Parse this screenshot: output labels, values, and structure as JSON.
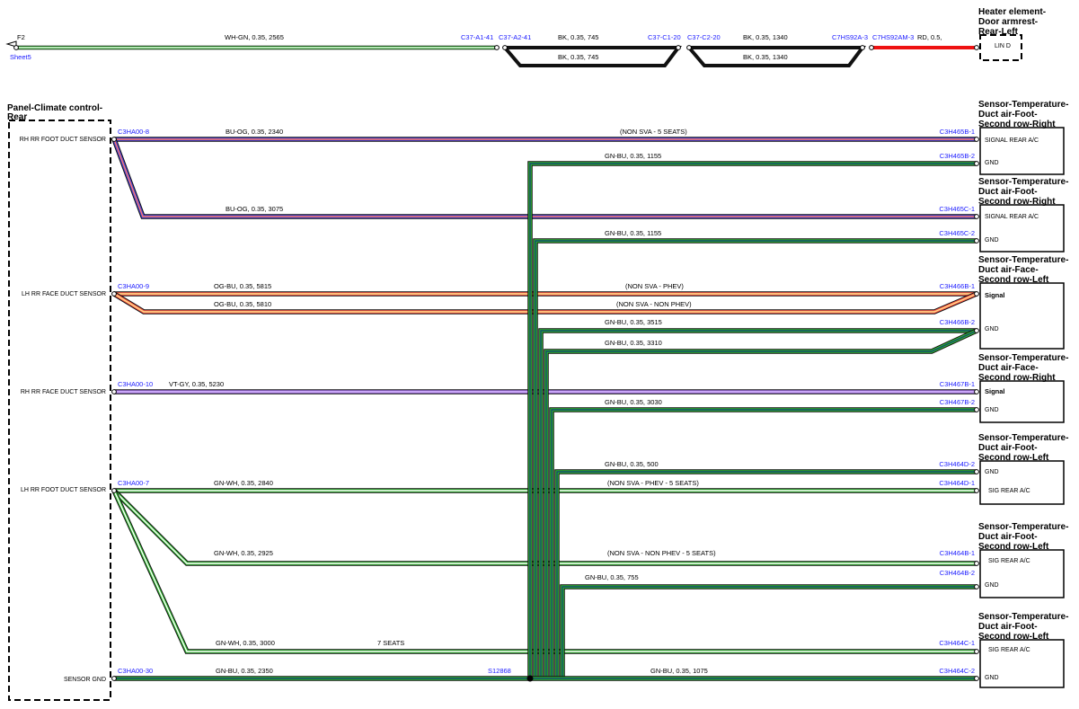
{
  "colors": {
    "connector_label": "#1a1aff",
    "wire_WH-GN": [
      "#111111",
      "#33bb33",
      "#ffffff"
    ],
    "wire_BK": [
      "#111111",
      "#111111",
      "#111111"
    ],
    "wire_RD": [
      "#ee1111",
      "#ee1111",
      "#ee1111"
    ],
    "wire_BU-OG": [
      "#111111",
      "#4444dd",
      "#ff7a6a"
    ],
    "wire_GN-BU": [
      "#111111",
      "#33bb33",
      "#114a6a"
    ],
    "wire_OG-BU": [
      "#111111",
      "#ff5a4a",
      "#ffdd88"
    ],
    "wire_VT-GY": [
      "#111111",
      "#a070e0",
      "#d8b8ff"
    ],
    "wire_GN-WH": [
      "#111111",
      "#33bb33",
      "#ffffff"
    ]
  },
  "top": {
    "f2": "F2",
    "sheet": "Sheet5",
    "wire_wh_gn": "WH-GN,  0.35,  2565",
    "c37_a1": "C37-A1-41",
    "c37_a2": "C37-A2-41",
    "bk_745_a": "BK,  0.35,  745",
    "bk_745_b": "BK,  0.35,  745",
    "c37_c1": "C37-C1-20",
    "c37_c2": "C37-C2-20",
    "bk_1340_a": "BK,  0.35,  1340",
    "bk_1340_b": "BK,  0.35,  1340",
    "c7hs92a": "C7HS92A-3",
    "c7hs92am": "C7HS92AM-3",
    "rd": "RD,  0.5,",
    "heater_title": [
      "Heater element-",
      "Door armrest-",
      "Rear-Left"
    ],
    "lin_d": "LIN D"
  },
  "left_panel": {
    "title": [
      "Panel-Climate control-",
      "Rear"
    ],
    "pins": [
      {
        "label": "RH RR FOOT DUCT SENSOR",
        "connector": "C3HA00-8"
      },
      {
        "label": "LH RR FACE DUCT SENSOR",
        "connector": "C3HA00-9"
      },
      {
        "label": "RH RR FACE DUCT SENSOR",
        "connector": "C3HA00-10"
      },
      {
        "label": "LH RR FOOT DUCT SENSOR",
        "connector": "C3HA00-7"
      },
      {
        "label": "SENSOR GND",
        "connector": "C3HA00-30"
      }
    ]
  },
  "splice": "S12868",
  "wires": {
    "w1": {
      "label": "BU-OG,  0.35,  2340",
      "note": "(NON SVA - 5 SEATS)",
      "end": "C3H465B-1"
    },
    "w2": {
      "label": "GN-BU,  0.35,  1155",
      "end": "C3H465B-2"
    },
    "w3": {
      "label": "BU-OG,  0.35,  3075",
      "end": "C3H465C-1"
    },
    "w4": {
      "label": "GN-BU,  0.35,  1155",
      "end": "C3H465C-2"
    },
    "w5": {
      "label": "OG-BU,  0.35,  5815",
      "note": "(NON SVA - PHEV)",
      "end": "C3H466B-1"
    },
    "w6": {
      "label": "OG-BU,  0.35,  5810",
      "note": "(NON SVA - NON PHEV)"
    },
    "w7": {
      "label": "GN-BU,  0.35,  3515",
      "end": "C3H466B-2"
    },
    "w8": {
      "label": "GN-BU,  0.35,  3310"
    },
    "w9": {
      "label": "VT-GY,  0.35,  5230",
      "end": "C3H467B-1"
    },
    "w10": {
      "label": "GN-BU,  0.35,  3030",
      "end": "C3H467B-2"
    },
    "w11": {
      "label": "GN-BU,  0.35,  500",
      "end": "C3H464D-2"
    },
    "w12": {
      "label": "GN-WH,  0.35,  2840",
      "note": "(NON SVA - PHEV - 5 SEATS)",
      "end": "C3H464D-1"
    },
    "w13": {
      "label": "GN-WH,  0.35,  2925",
      "note": "(NON SVA - NON PHEV - 5 SEATS)",
      "end": "C3H464B-1"
    },
    "w14": {
      "label": "GN-BU,  0.35,  755",
      "end": "C3H464B-2"
    },
    "w15": {
      "label": "GN-WH,  0.35,  3000",
      "note": "7 SEATS",
      "end": "C3H464C-1"
    },
    "w16": {
      "label": "GN-BU,  0.35,  2350"
    },
    "w17": {
      "label": "GN-BU,  0.35,  1075",
      "end": "C3H464C-2"
    }
  },
  "components": [
    {
      "title": [
        "Sensor-Temperature-",
        "Duct air-Foot-",
        "Second row-Right"
      ],
      "pins": [
        "SIGNAL REAR A/C",
        "GND"
      ]
    },
    {
      "title": [
        "Sensor-Temperature-",
        "Duct air-Foot-",
        "Second row-Right"
      ],
      "pins": [
        "SIGNAL REAR A/C",
        "GND"
      ]
    },
    {
      "title": [
        "Sensor-Temperature-",
        "Duct air-Face-",
        "Second row-Left"
      ],
      "pins": [
        "Signal",
        "GND"
      ]
    },
    {
      "title": [
        "Sensor-Temperature-",
        "Duct air-Face-",
        "Second row-Right"
      ],
      "pins": [
        "Signal",
        "GND"
      ]
    },
    {
      "title": [
        "Sensor-Temperature-",
        "Duct air-Foot-",
        "Second row-Left"
      ],
      "pins": [
        "GND",
        "SIG REAR A/C"
      ]
    },
    {
      "title": [
        "Sensor-Temperature-",
        "Duct air-Foot-",
        "Second row-Left"
      ],
      "pins": [
        "SIG REAR A/C",
        "GND"
      ]
    },
    {
      "title": [
        "Sensor-Temperature-",
        "Duct air-Foot-",
        "Second row-Left"
      ],
      "pins": [
        "SIG REAR A/C",
        "GND"
      ]
    }
  ]
}
